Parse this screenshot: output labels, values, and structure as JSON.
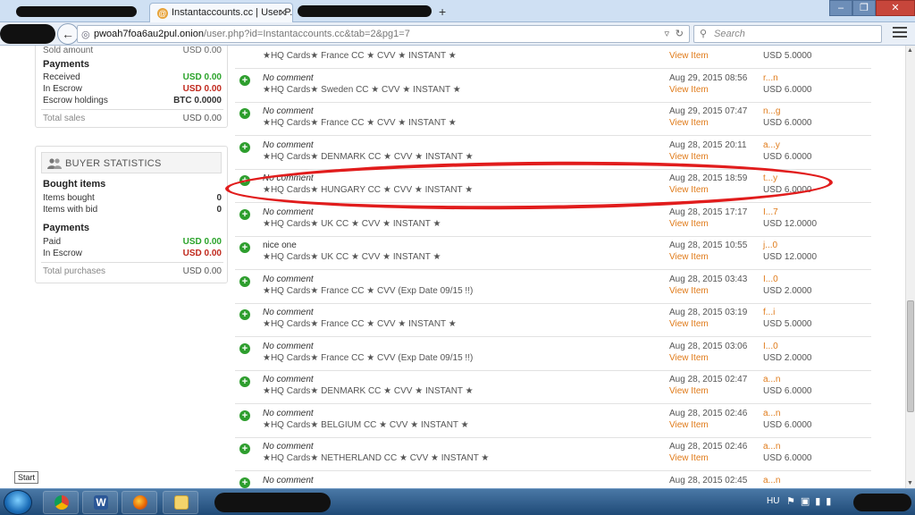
{
  "browser": {
    "active_tab_title": "Instantaccounts.cc | User P...",
    "favicon_letter": "@",
    "url_host": "pwoah7foa6au2pul.onion",
    "url_path": "/user.php?id=Instantaccounts.cc&tab=2&pg1=7",
    "search_placeholder": "Search",
    "new_tab_symbol": "+",
    "window_buttons": [
      "–",
      "❐",
      "✕"
    ]
  },
  "sidebar": {
    "seller": {
      "sold_amount_label": "Sold amount",
      "sold_amount_value": "USD 0.00",
      "payments_heading": "Payments",
      "rows": [
        {
          "label": "Received",
          "value": "USD 0.00",
          "color": "#2aa32a"
        },
        {
          "label": "In Escrow",
          "value": "USD 0.00",
          "color": "#c0281c"
        },
        {
          "label": "Escrow holdings",
          "value": "BTC 0.0000",
          "color": "#333333"
        }
      ],
      "total_label": "Total sales",
      "total_value": "USD 0.00"
    },
    "buyer": {
      "title": "BUYER STATISTICS",
      "bought_heading": "Bought items",
      "items_bought_label": "Items bought",
      "items_bought_value": "0",
      "items_bid_label": "Items with bid",
      "items_bid_value": "0",
      "payments_heading": "Payments",
      "paid_label": "Paid",
      "paid_value": "USD 0.00",
      "escrow_label": "In Escrow",
      "escrow_value": "USD 0.00",
      "total_label": "Total purchases",
      "total_value": "USD 0.00"
    }
  },
  "feedback": [
    {
      "comment": "",
      "title": "★HQ Cards★ France CC ★ CVV ★ INSTANT ★",
      "date": "",
      "link": "View Item",
      "user": "",
      "price": "USD 5.0000"
    },
    {
      "comment": "No comment",
      "title": "★HQ Cards★ Sweden CC ★ CVV ★ INSTANT ★",
      "date": "Aug 29, 2015 08:56",
      "link": "View Item",
      "user": "r...n",
      "price": "USD 6.0000"
    },
    {
      "comment": "No comment",
      "title": "★HQ Cards★ France CC ★ CVV ★ INSTANT ★",
      "date": "Aug 29, 2015 07:47",
      "link": "View Item",
      "user": "n...g",
      "price": "USD 6.0000"
    },
    {
      "comment": "No comment",
      "title": "★HQ Cards★ DENMARK CC ★ CVV ★ INSTANT ★",
      "date": "Aug 28, 2015 20:11",
      "link": "View Item",
      "user": "a...y",
      "price": "USD 6.0000"
    },
    {
      "comment": "No comment",
      "title": "★HQ Cards★ HUNGARY CC ★ CVV ★ INSTANT ★",
      "date": "Aug 28, 2015 18:59",
      "link": "View Item",
      "user": "t...y",
      "price": "USD 6.0000"
    },
    {
      "comment": "No comment",
      "title": "★HQ Cards★ UK CC ★ CVV ★ INSTANT ★",
      "date": "Aug 28, 2015 17:17",
      "link": "View Item",
      "user": "I...7",
      "price": "USD 12.0000"
    },
    {
      "comment": "nice one",
      "title": "★HQ Cards★ UK CC ★ CVV ★ INSTANT ★",
      "date": "Aug 28, 2015 10:55",
      "link": "View Item",
      "user": "j...0",
      "price": "USD 12.0000"
    },
    {
      "comment": "No comment",
      "title": "★HQ Cards★ France CC ★ CVV (Exp Date 09/15 !!)",
      "date": "Aug 28, 2015 03:43",
      "link": "View Item",
      "user": "I...0",
      "price": "USD 2.0000"
    },
    {
      "comment": "No comment",
      "title": "★HQ Cards★ France CC ★ CVV ★ INSTANT ★",
      "date": "Aug 28, 2015 03:19",
      "link": "View Item",
      "user": "f...i",
      "price": "USD 5.0000"
    },
    {
      "comment": "No comment",
      "title": "★HQ Cards★ France CC ★ CVV (Exp Date 09/15 !!)",
      "date": "Aug 28, 2015 03:06",
      "link": "View Item",
      "user": "I...0",
      "price": "USD 2.0000"
    },
    {
      "comment": "No comment",
      "title": "★HQ Cards★ DENMARK CC ★ CVV ★ INSTANT ★",
      "date": "Aug 28, 2015 02:47",
      "link": "View Item",
      "user": "a...n",
      "price": "USD 6.0000"
    },
    {
      "comment": "No comment",
      "title": "★HQ Cards★ BELGIUM CC ★ CVV ★ INSTANT ★",
      "date": "Aug 28, 2015 02:46",
      "link": "View Item",
      "user": "a...n",
      "price": "USD 6.0000"
    },
    {
      "comment": "No comment",
      "title": "★HQ Cards★ NETHERLAND CC ★ CVV ★ INSTANT ★",
      "date": "Aug 28, 2015 02:46",
      "link": "View Item",
      "user": "a...n",
      "price": "USD 6.0000"
    },
    {
      "comment": "No comment",
      "title": "",
      "date": "Aug 28, 2015 02:45",
      "link": "",
      "user": "a...n",
      "price": ""
    }
  ],
  "taskbar": {
    "tooltip": "Start",
    "language": "HU"
  },
  "colors": {
    "accent_link": "#e07b1a",
    "positive": "#2aa32a",
    "negative": "#c0281c",
    "annotation": "#e11c1c"
  }
}
